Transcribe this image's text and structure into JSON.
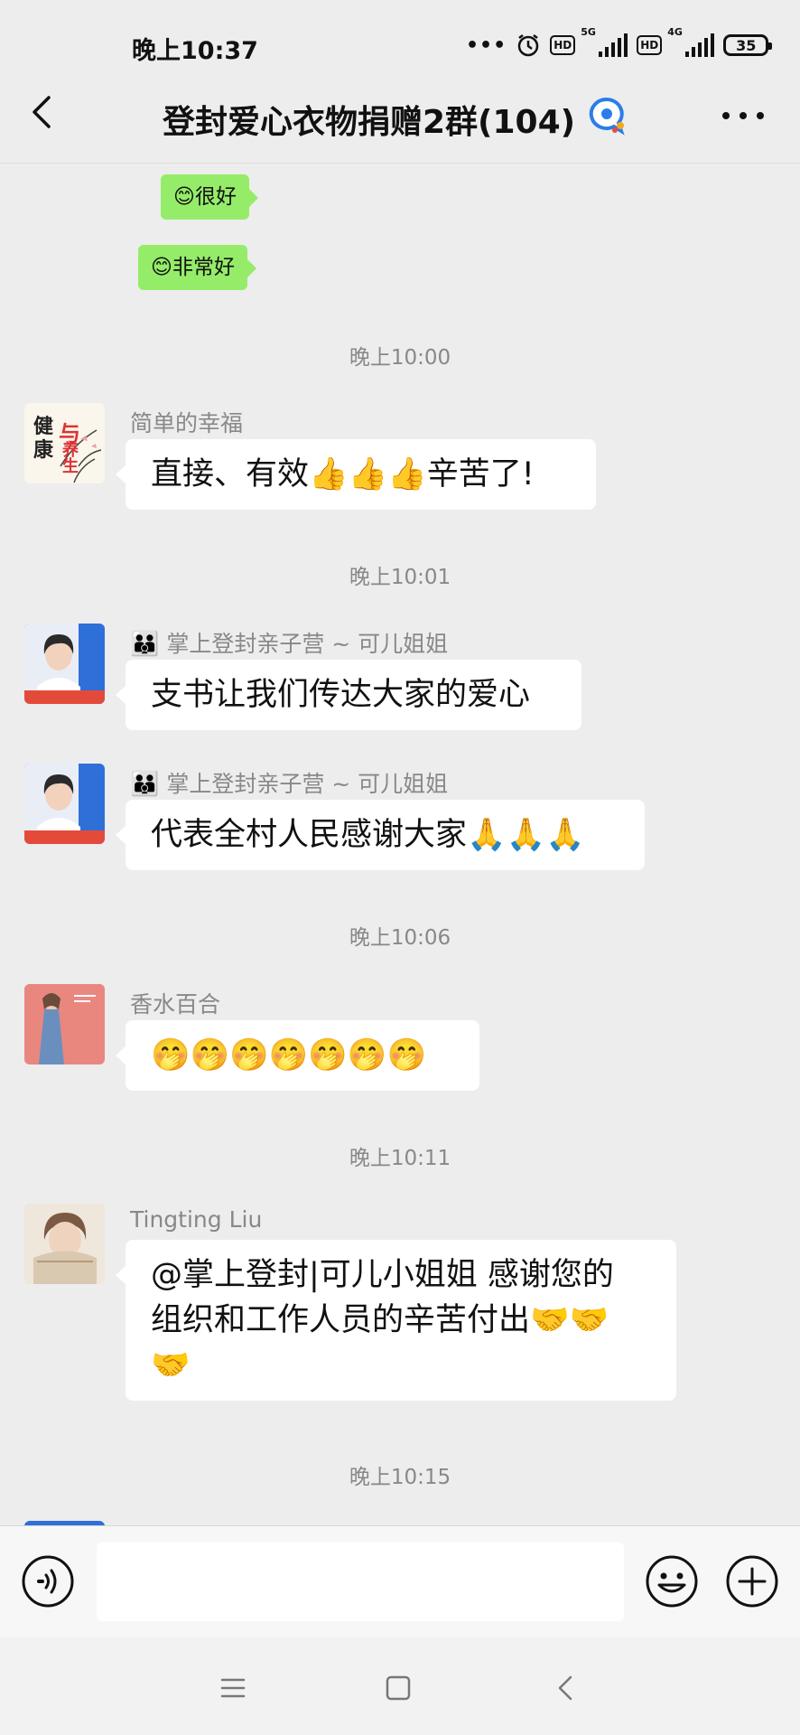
{
  "status_bar": {
    "time": "晚上10:37",
    "sig1_label": "5G",
    "sig2_label": "4G",
    "hd": "HD",
    "battery": "35"
  },
  "nav": {
    "title": "登封爱心衣物捐赠2群(104)"
  },
  "messages": {
    "self1": "😊很好",
    "self2": "😊非常好",
    "ts1": "晚上10:00",
    "m1_sender": "简单的幸福",
    "m1_text": "直接、有效👍👍👍辛苦了!",
    "ts2": "晚上10:01",
    "m2_sender_icon": "👪",
    "m2_sender": "掌上登封亲子营 ~ 可儿姐姐",
    "m2_text": "支书让我们传达大家的爱心",
    "m3_sender_icon": "👪",
    "m3_sender": "掌上登封亲子营 ~ 可儿姐姐",
    "m3_text": "代表全村人民感谢大家🙏🙏🙏",
    "ts3": "晚上10:06",
    "m4_sender": "香水百合",
    "m4_text": "🤭🤭🤭🤭🤭🤭🤭",
    "ts4": "晚上10:11",
    "m5_sender": "Tingting Liu",
    "m5_text_line1": "@掌上登封|可儿小姐姐  感谢您的",
    "m5_text_line2": "组织和工作人员的辛苦付出🤝🤝",
    "m5_text_line3": "🤝",
    "ts5": "晚上10:15"
  },
  "avatars": {
    "m1_line1": "健",
    "m1_line2": "康",
    "m1_line3": "与",
    "m1_line4": "养生"
  },
  "input": {
    "placeholder": ""
  }
}
